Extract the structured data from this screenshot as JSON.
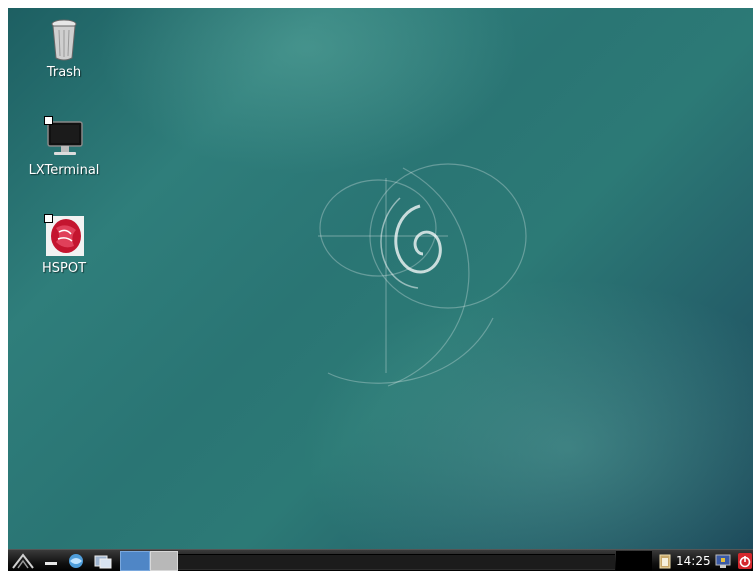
{
  "desktop": {
    "icons": [
      {
        "label": "Trash",
        "icon": "trash-icon"
      },
      {
        "label": "LXTerminal",
        "icon": "monitor-icon"
      },
      {
        "label": "HSPOT",
        "icon": "hspot-app-icon"
      }
    ]
  },
  "taskbar": {
    "clock": "14:25",
    "launchers": [
      "start-menu-icon",
      "minimize-all-icon",
      "browser-icon",
      "window-switcher-icon"
    ],
    "workspaces": [
      "workspace-1",
      "workspace-2"
    ]
  },
  "colors": {
    "desktop_primary": "#2a7574",
    "taskbar": "#111111",
    "workspace_active": "#4f86c6",
    "workspace_inactive": "#b8b8b8"
  }
}
